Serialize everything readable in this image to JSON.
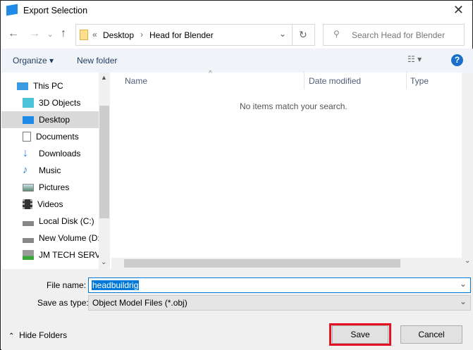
{
  "window": {
    "title": "Export Selection"
  },
  "address": {
    "crumbs": [
      "Desktop",
      "Head for Blender"
    ],
    "prefix": "«"
  },
  "search": {
    "placeholder": "Search Head for Blender"
  },
  "toolbar": {
    "organize": "Organize",
    "new_folder": "New folder",
    "help": "?"
  },
  "sidebar": {
    "items": [
      {
        "label": "This PC",
        "icon": "computer-icon"
      },
      {
        "label": "3D Objects",
        "icon": "cube-icon"
      },
      {
        "label": "Desktop",
        "icon": "desktop-icon",
        "selected": true
      },
      {
        "label": "Documents",
        "icon": "document-icon"
      },
      {
        "label": "Downloads",
        "icon": "download-icon"
      },
      {
        "label": "Music",
        "icon": "music-icon"
      },
      {
        "label": "Pictures",
        "icon": "pictures-icon"
      },
      {
        "label": "Videos",
        "icon": "videos-icon"
      },
      {
        "label": "Local Disk (C:)",
        "icon": "drive-icon"
      },
      {
        "label": "New Volume (D:)",
        "icon": "drive-icon"
      },
      {
        "label": "JM TECH SERVICES",
        "icon": "network-drive-icon"
      }
    ]
  },
  "columns": [
    "Name",
    "Date modified",
    "Type"
  ],
  "empty_message": "No items match your search.",
  "form": {
    "file_name_label": "File name:",
    "file_name": "headbuildrig",
    "type_label": "Save as type:",
    "type_value": "Object Model Files (*.obj)"
  },
  "buttons": {
    "hide_folders": "Hide Folders",
    "save": "Save",
    "cancel": "Cancel"
  },
  "colors": {
    "accent": "#0078d7",
    "highlight": "#e81123"
  }
}
